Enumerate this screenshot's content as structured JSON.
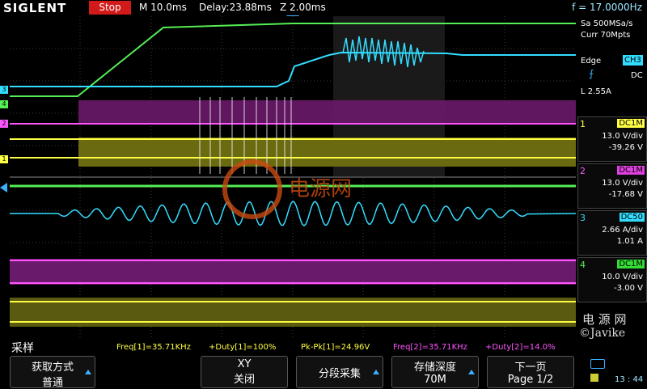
{
  "top": {
    "brand": "SIGLENT",
    "run_state": "Stop",
    "timebase": "M 10.0ms",
    "delay": "Delay:23.88ms",
    "zoom": "Z 2.00ms",
    "frequency": "f = 17.0000Hz"
  },
  "right": {
    "sample_rate": "Sa 500MSa/s",
    "memory": "Curr 70Mpts",
    "trigger_type": "Edge",
    "trigger_source": "CH3",
    "coupling": "DC",
    "level": "L  2.55A",
    "channels": [
      {
        "num": "1",
        "coupling": "DC1M",
        "scale": "13.0 V/div",
        "offset": "-39.26 V",
        "color": "#ffff33"
      },
      {
        "num": "2",
        "coupling": "DC1M",
        "scale": "13.0 V/div",
        "offset": "-17.68 V",
        "color": "#e040e0"
      },
      {
        "num": "3",
        "coupling": "DC50",
        "scale": "2.66 A/div",
        "offset": "1.01 A",
        "color": "#33e0ff"
      },
      {
        "num": "4",
        "coupling": "DC1M",
        "scale": "10.0 V/div",
        "offset": "-3.00 V",
        "color": "#33dd33"
      }
    ],
    "watermark_cn": "电 源 网",
    "watermark_author": "©Javike",
    "clock": "13 : 44"
  },
  "status": {
    "mode_label": "采样",
    "meas1": "Freq[1]=35.71KHz",
    "meas2": "+Duty[1]=100%",
    "meas3": "Pk-Pk[1]=24.96V",
    "meas4": "Freq[2]=35.71KHz",
    "meas5": "+Duty[2]=14.0%"
  },
  "menu": {
    "acq_mode_title": "获取方式",
    "acq_mode_value": "普通",
    "xy_title": "XY",
    "xy_value": "关闭",
    "segment": "分段采集",
    "mem_depth_title": "存储深度",
    "mem_depth_value": "70M",
    "next_page_title": "下一页",
    "next_page_value": "Page 1/2"
  },
  "watermark_center": "电源网"
}
